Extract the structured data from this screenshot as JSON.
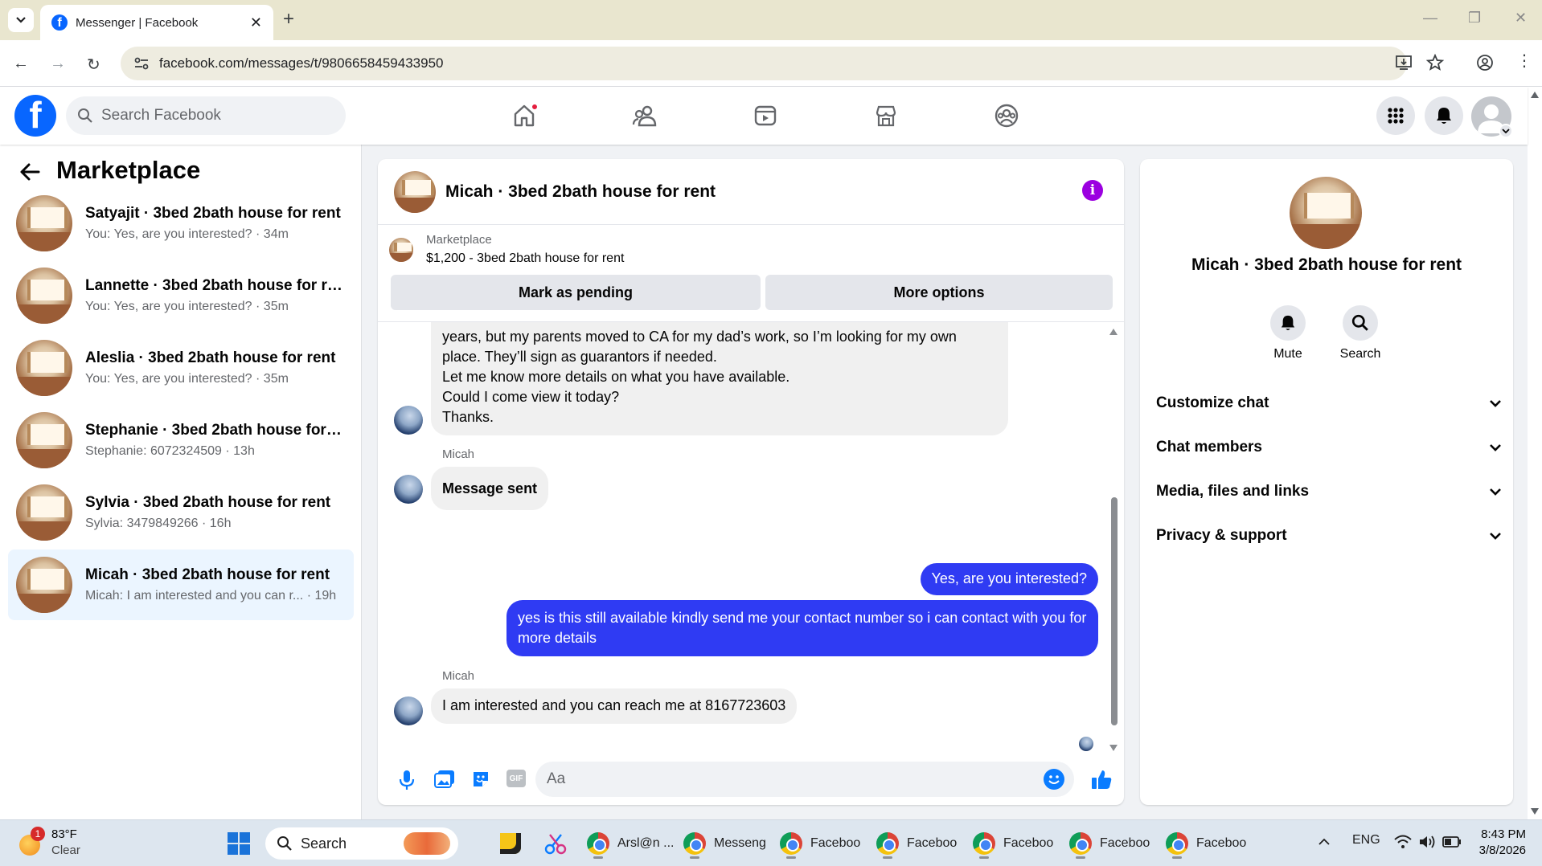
{
  "browser": {
    "tab_title": "Messenger | Facebook",
    "url": "facebook.com/messages/t/9806658459433950"
  },
  "fb_header": {
    "search_placeholder": "Search Facebook"
  },
  "left_panel": {
    "title": "Marketplace",
    "conversations": [
      {
        "name": "Satyajit · 3bed 2bath house for rent",
        "preview": "You: Yes, are you interested? · 34m"
      },
      {
        "name": "Lannette · 3bed 2bath house for re...",
        "preview": "You: Yes, are you interested? · 35m"
      },
      {
        "name": "Aleslia · 3bed 2bath house for rent",
        "preview": "You: Yes, are you interested? · 35m"
      },
      {
        "name": "Stephanie · 3bed 2bath house for r...",
        "preview": "Stephanie: 6072324509 · 13h"
      },
      {
        "name": "Sylvia · 3bed 2bath house for rent",
        "preview": "Sylvia: 3479849266 · 16h"
      },
      {
        "name": "Micah · 3bed 2bath house for rent",
        "preview": "Micah: I am interested and you can r... · 19h"
      }
    ]
  },
  "chat": {
    "title": "Micah · 3bed 2bath house for rent",
    "marketplace_label": "Marketplace",
    "listing": "$1,200 - 3bed 2bath house for rent",
    "mark_pending": "Mark as pending",
    "more_options": "More options",
    "messages": {
      "long_line1": "years, but my parents moved to CA for my dad’s work, so I’m looking for my own",
      "long_line2": "place. They’ll sign as guarantors if needed.",
      "long_line3": "Let me know more details on what you have available.",
      "long_line4": "Could I come view it today?",
      "long_line5": "Thanks.",
      "sender1": "Micah",
      "sent_notice": "Message sent",
      "out1": "Yes, are you interested?",
      "out2": "yes is this still available kindly send me your contact number so i can contact with you for more details",
      "sender2": "Micah",
      "in_last": "I am interested and you can reach me at 8167723603"
    },
    "composer_placeholder": "Aa"
  },
  "right_panel": {
    "title": "Micah · 3bed 2bath house for rent",
    "mute": "Mute",
    "search": "Search",
    "sections": [
      "Customize chat",
      "Chat members",
      "Media, files and links",
      "Privacy & support"
    ]
  },
  "taskbar": {
    "temp": "83°F",
    "condition": "Clear",
    "weather_badge": "1",
    "search": "Search",
    "apps": [
      "Arsl@n ...",
      "Messeng",
      "Faceboo",
      "Faceboo",
      "Faceboo",
      "Faceboo",
      "Faceboo"
    ],
    "lang": "ENG",
    "time": "8:43 PM",
    "date": "3/8/2026"
  },
  "colors": {
    "fb_blue": "#0866ff",
    "outgoing_bubble": "#2f3bf3",
    "info_purple": "#9b00e0"
  }
}
